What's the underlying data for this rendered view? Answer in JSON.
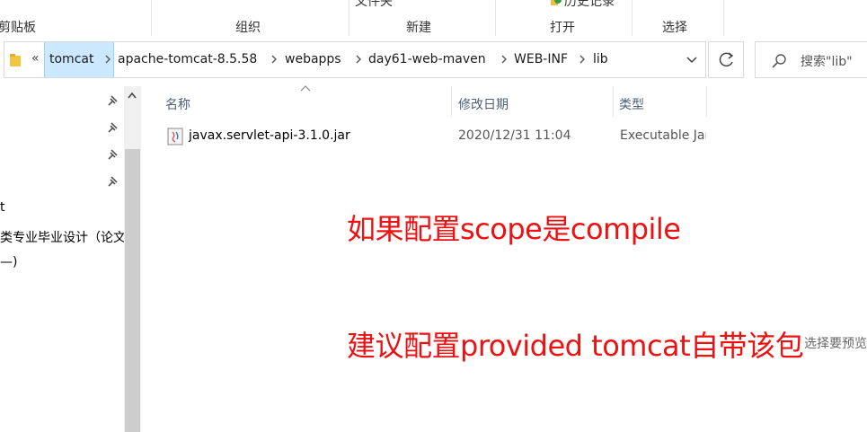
{
  "ribbon": {
    "clipboard_label": "剪贴板",
    "organize_label": "组织",
    "new_label": "新建",
    "new_folder_cut": "文件夹",
    "open_label": "打开",
    "history_cut": "历史记录",
    "select_label": "选择"
  },
  "address": {
    "overflow": "«",
    "crumbs": [
      "tomcat",
      "apache-tomcat-8.5.58",
      "webapps",
      "day61-web-maven",
      "WEB-INF",
      "lib"
    ],
    "search_placeholder": "搜索\"lib\""
  },
  "nav": {
    "items": [
      "t",
      "类专业毕业设计（论文",
      "—)"
    ]
  },
  "columns": {
    "name": "名称",
    "modified": "修改日期",
    "type": "类型"
  },
  "files": [
    {
      "name": "javax.servlet-api-3.1.0.jar",
      "modified": "2020/12/31 11:04",
      "type": "Executable Jar File"
    }
  ],
  "annotations": {
    "line1": "如果配置scope是compile",
    "line2": "建议配置provided  tomcat自带该包"
  },
  "preview_hint": "选择要预览",
  "colors": {
    "annotation": "#ee1111",
    "selected_crumb": "#cce8ff",
    "header_text": "#4c607a"
  }
}
